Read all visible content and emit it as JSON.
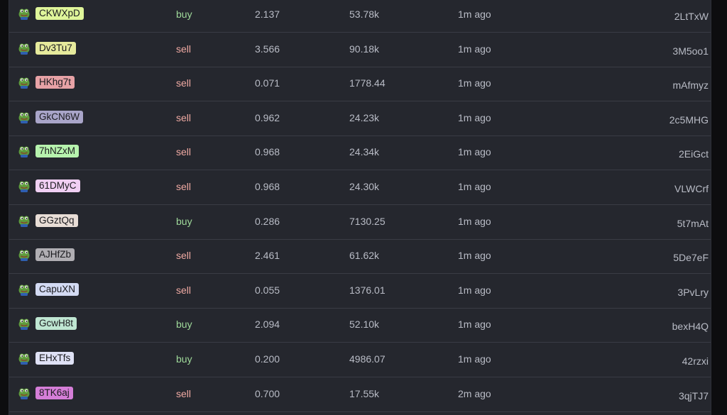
{
  "colors": {
    "background": "#25272e",
    "buy": "#9fd99a",
    "sell": "#f0aaa3",
    "row_divider": "#3a3c45"
  },
  "avatar_icon": "frog-icon",
  "rows": [
    {
      "token": "CKWXpD",
      "token_color": "#dff59a",
      "side": "buy",
      "amount": "2.137",
      "value": "53.78k",
      "time": "1m ago",
      "maker": "2LtTxW"
    },
    {
      "token": "Dv3Tu7",
      "token_color": "#e6ea9c",
      "side": "sell",
      "amount": "3.566",
      "value": "90.18k",
      "time": "1m ago",
      "maker": "3M5oo1"
    },
    {
      "token": "HKhg7t",
      "token_color": "#e7a2a6",
      "side": "sell",
      "amount": "0.071",
      "value": "1778.44",
      "time": "1m ago",
      "maker": "mAfmyz"
    },
    {
      "token": "GkCN6W",
      "token_color": "#a9a5c9",
      "side": "sell",
      "amount": "0.962",
      "value": "24.23k",
      "time": "1m ago",
      "maker": "2c5MHG"
    },
    {
      "token": "7hNZxM",
      "token_color": "#b7f3ae",
      "side": "sell",
      "amount": "0.968",
      "value": "24.34k",
      "time": "1m ago",
      "maker": "2EiGct"
    },
    {
      "token": "61DMyC",
      "token_color": "#f0cff3",
      "side": "sell",
      "amount": "0.968",
      "value": "24.30k",
      "time": "1m ago",
      "maker": "VLWCrf"
    },
    {
      "token": "GGztQq",
      "token_color": "#e8ddd6",
      "side": "buy",
      "amount": "0.286",
      "value": "7130.25",
      "time": "1m ago",
      "maker": "5t7mAt"
    },
    {
      "token": "AJHfZb",
      "token_color": "#b0aeb3",
      "side": "sell",
      "amount": "2.461",
      "value": "61.62k",
      "time": "1m ago",
      "maker": "5De7eF"
    },
    {
      "token": "CapuXN",
      "token_color": "#d3daf3",
      "side": "sell",
      "amount": "0.055",
      "value": "1376.01",
      "time": "1m ago",
      "maker": "3PvLry"
    },
    {
      "token": "GcwH8t",
      "token_color": "#bfe6d2",
      "side": "buy",
      "amount": "2.094",
      "value": "52.10k",
      "time": "1m ago",
      "maker": "bexH4Q"
    },
    {
      "token": "EHxTfs",
      "token_color": "#dfe1f5",
      "side": "buy",
      "amount": "0.200",
      "value": "4986.07",
      "time": "1m ago",
      "maker": "42rzxi"
    },
    {
      "token": "8TK6aj",
      "token_color": "#d57ed8",
      "side": "sell",
      "amount": "0.700",
      "value": "17.55k",
      "time": "2m ago",
      "maker": "3qjTJ7"
    }
  ]
}
